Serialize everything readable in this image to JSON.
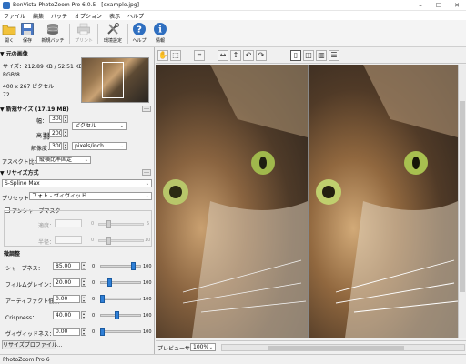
{
  "window": {
    "title": "BenVista PhotoZoom Pro 6.0.5 - [example.jpg]"
  },
  "menu": [
    "ファイル",
    "編集",
    "バッチ",
    "オプション",
    "表示",
    "ヘルプ"
  ],
  "toolbar": {
    "open": "開く",
    "save": "保存",
    "new_batch": "新規バッチ",
    "print": "プリント",
    "env_settings": "環境設定",
    "help": "ヘルプ",
    "info": "情報"
  },
  "source": {
    "header": "▼ 元の画像",
    "size": "サイズ：212.89 KB / 52.51 KB",
    "mode": "RGB/8",
    "dims": "400 x 267 ピクセル",
    "dpi": "72"
  },
  "newsize": {
    "header": "▼ 新規サイズ (17.19 MB)",
    "width_label": "幅：",
    "width": "3000",
    "height_label": "高さ：",
    "height": "2003",
    "res_label": "解像度：",
    "res": "300",
    "unit_pixels": "ピクセル",
    "unit_res": "pixels/inch",
    "aspect_label": "アスペクト比：",
    "aspect": "縦横比率固定"
  },
  "resize": {
    "header": "▼ リサイズ方式",
    "method": "S-Spline Max",
    "preset_label": "プリセット：",
    "preset": "フォト - ヴィヴィッド",
    "unsharp_label": "アンシャープマスク",
    "amount_label": "適度：",
    "amount_max": "5",
    "radius_label": "半径：",
    "radius_max": "10",
    "amount_level": 0.2,
    "radius_level": 0.2
  },
  "finetune": {
    "header": "微調整",
    "rows": [
      {
        "label": "シャープネス：",
        "value": "85.00",
        "min": "0",
        "max": "100",
        "level": 0.85
      },
      {
        "label": "フィルムグレイン：",
        "value": "20.00",
        "min": "0",
        "max": "100",
        "level": 0.2
      },
      {
        "label": "アーティファクト低減：",
        "value": "0.00",
        "min": "0",
        "max": "100",
        "level": 0.0
      },
      {
        "label": "Crispness：",
        "value": "40.00",
        "min": "0",
        "max": "100",
        "level": 0.4
      },
      {
        "label": "ヴィヴィッドネス：",
        "value": "0.00",
        "min": "0",
        "max": "100",
        "level": 0.0
      }
    ]
  },
  "profile_button": "リサイズプロファイル...",
  "preview": {
    "label": "プレビューサイズ：",
    "zoom": "100%"
  },
  "status": "PhotoZoom Pro 6",
  "colors": {
    "accent": "#2f7fd6",
    "panel": "#f0f0f0"
  }
}
